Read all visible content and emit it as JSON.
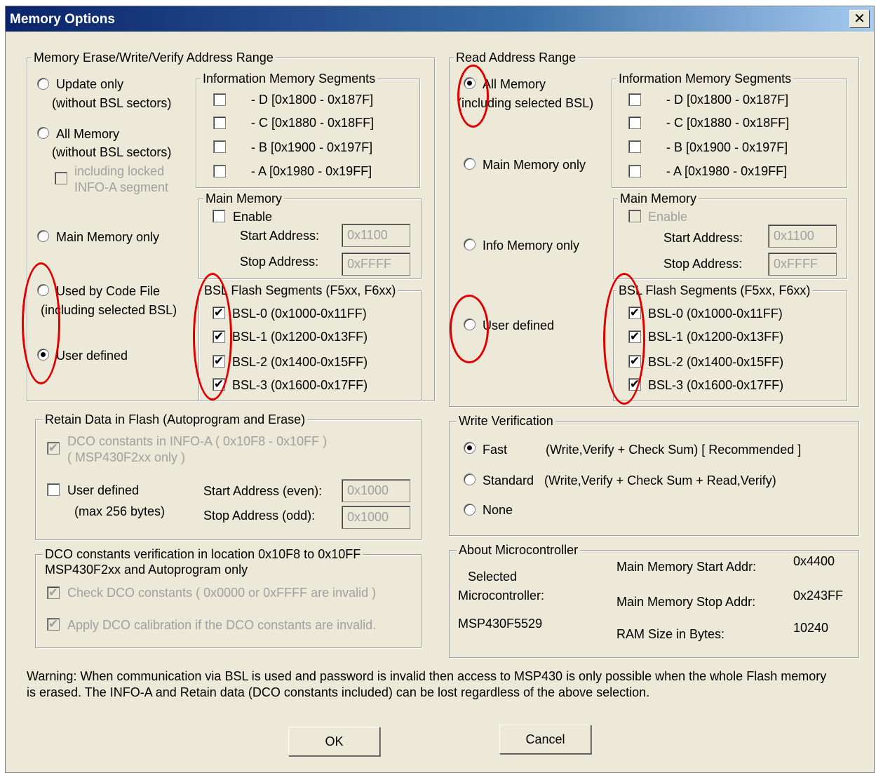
{
  "window": {
    "title": "Memory Options",
    "close_glyph": "✕"
  },
  "erase": {
    "legend": "Memory Erase/Write/Verify Address Range",
    "opt_update": "Update only",
    "opt_update_sub": "(without BSL sectors)",
    "opt_all": "All Memory",
    "opt_all_sub": "(without BSL sectors)",
    "locked_l1": "including locked",
    "locked_l2": "INFO-A segment",
    "opt_main": "Main Memory only",
    "opt_codefile": "Used by Code File",
    "opt_codefile_sub": "(including selected BSL)",
    "opt_user": "User defined",
    "selected": "User defined",
    "info_legend": "Information Memory Segments",
    "info_segments": [
      {
        "label": "- D  [0x1800 - 0x187F]",
        "checked": false
      },
      {
        "label": "- C  [0x1880 - 0x18FF]",
        "checked": false
      },
      {
        "label": "- B  [0x1900 - 0x197F]",
        "checked": false
      },
      {
        "label": "- A  [0x1980 - 0x19FF]",
        "checked": false
      }
    ],
    "main_legend": "Main Memory",
    "enable": "Enable",
    "start_label": "Start Address:",
    "stop_label": "Stop Address:",
    "start_value": "0x1100",
    "stop_value": "0xFFFF",
    "bsl_legend": "BSL Flash Segments (F5xx, F6xx)",
    "bsl_segments": [
      {
        "label": "BSL-0 (0x1000-0x11FF)",
        "checked": true
      },
      {
        "label": "BSL-1 (0x1200-0x13FF)",
        "checked": true
      },
      {
        "label": "BSL-2 (0x1400-0x15FF)",
        "checked": true
      },
      {
        "label": "BSL-3 (0x1600-0x17FF)",
        "checked": true
      }
    ]
  },
  "read": {
    "legend": "Read Address Range",
    "opt_all": "All Memory",
    "opt_all_sub": "(including selected BSL)",
    "opt_main": "Main Memory only",
    "opt_info": "Info Memory only",
    "opt_user": "User defined",
    "selected": "All Memory",
    "info_legend": "Information Memory Segments",
    "info_segments": [
      {
        "label": "- D  [0x1800 - 0x187F]",
        "checked": false
      },
      {
        "label": "- C  [0x1880 - 0x18FF]",
        "checked": false
      },
      {
        "label": "- B  [0x1900 - 0x197F]",
        "checked": false
      },
      {
        "label": "- A  [0x1980 - 0x19FF]",
        "checked": false
      }
    ],
    "main_legend": "Main Memory",
    "enable": "Enable",
    "start_label": "Start Address:",
    "stop_label": "Stop Address:",
    "start_value": "0x1100",
    "stop_value": "0xFFFF",
    "bsl_legend": "BSL Flash Segments (F5xx, F6xx)",
    "bsl_segments": [
      {
        "label": "BSL-0 (0x1000-0x11FF)",
        "checked": true
      },
      {
        "label": "BSL-1 (0x1200-0x13FF)",
        "checked": true
      },
      {
        "label": "BSL-2 (0x1400-0x15FF)",
        "checked": true
      },
      {
        "label": "BSL-3 (0x1600-0x17FF)",
        "checked": true
      }
    ]
  },
  "retain": {
    "legend": "Retain Data in Flash   (Autoprogram and Erase)",
    "dco_l1": "DCO constants in INFO-A ( 0x10F8 - 0x10FF )",
    "dco_l2": "( MSP430F2xx only )",
    "user_defined": "User defined",
    "max_bytes": "(max 256 bytes)",
    "start_label": "Start Address (even):",
    "stop_label": "Stop Address (odd):",
    "start_value": "0x1000",
    "stop_value": "0x1000"
  },
  "dco": {
    "legend_l1": "DCO constants verification in location 0x10F8 to 0x10FF",
    "legend_l2": "MSP430F2xx and Autoprogram only",
    "check": "Check DCO constants ( 0x0000 or 0xFFFF are invalid )",
    "apply": "Apply DCO calibration if the DCO constants are invalid."
  },
  "verify": {
    "legend": "Write Verification",
    "fast": "Fast",
    "fast_desc": "(Write,Verify + Check Sum)  [ Recommended ]",
    "standard": "Standard",
    "standard_desc": "(Write,Verify + Check Sum + Read,Verify)",
    "none": "None",
    "selected": "Fast"
  },
  "about": {
    "legend": "About Microcontroller",
    "selected_l1": "Selected",
    "selected_l2": "Microcontroller:",
    "device": "MSP430F5529",
    "start_label": "Main Memory Start Addr:",
    "start_value": "0x4400",
    "stop_label": "Main Memory Stop Addr:",
    "stop_value": "0x243FF",
    "ram_label": "RAM Size in Bytes:",
    "ram_value": "10240"
  },
  "warning": {
    "l1": "Warning: When communication via BSL is used and password is invalid then access to MSP430 is only possible when the whole Flash memory",
    "l2": "is erased. The INFO-A and Retain data (DCO constants included) can be lost regardless of the above selection."
  },
  "buttons": {
    "ok": "OK",
    "cancel": "Cancel"
  },
  "annotation": {
    "color": "#e00000"
  }
}
